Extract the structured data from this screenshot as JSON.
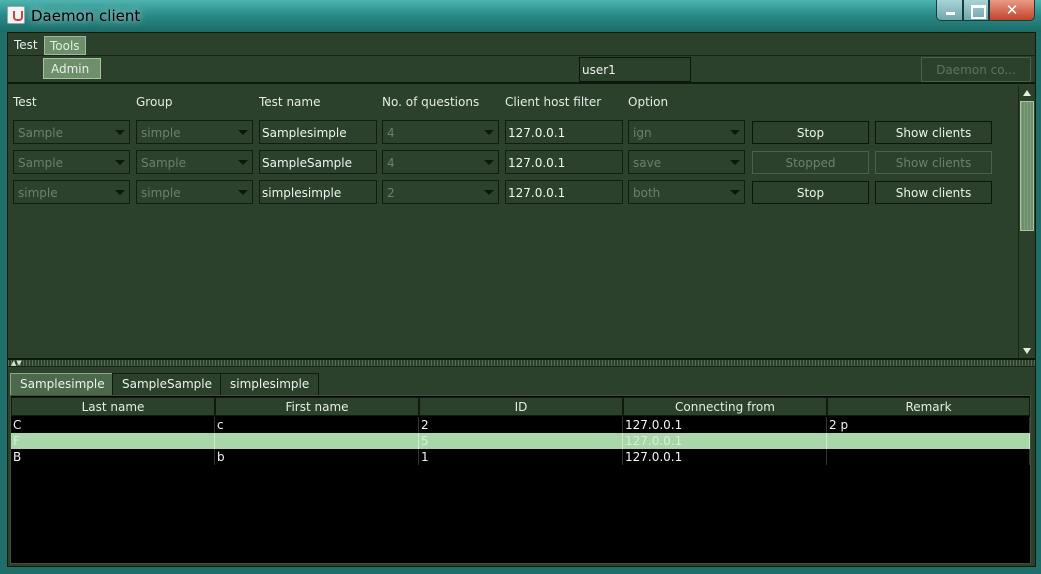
{
  "window": {
    "title": "Daemon client"
  },
  "menu": {
    "items": [
      "Test",
      "Tools"
    ],
    "tools_dropdown": [
      "Admin"
    ]
  },
  "toolbar": {
    "user": "user1",
    "daemon_button": "Daemon co..."
  },
  "columns": {
    "test": "Test",
    "group": "Group",
    "test_name": "Test name",
    "questions": "No. of questions",
    "host_filter": "Client host filter",
    "option": "Option"
  },
  "rows": [
    {
      "test": "Sample",
      "group": "simple",
      "test_name": "Samplesimple",
      "questions": "4",
      "host": "127.0.0.1",
      "option": "ign",
      "action": "Stop",
      "show": "Show clients",
      "enabled": true
    },
    {
      "test": "Sample",
      "group": "Sample",
      "test_name": "SampleSample",
      "questions": "4",
      "host": "127.0.0.1",
      "option": "save",
      "action": "Stopped",
      "show": "Show clients",
      "enabled": false
    },
    {
      "test": "simple",
      "group": "simple",
      "test_name": "simplesimple",
      "questions": "2",
      "host": "127.0.0.1",
      "option": "both",
      "action": "Stop",
      "show": "Show clients",
      "enabled": true
    }
  ],
  "tabs": [
    "Samplesimple",
    "SampleSample",
    "simplesimple"
  ],
  "active_tab": 0,
  "table": {
    "headers": [
      "Last name",
      "First name",
      "ID",
      "Connecting from",
      "Remark"
    ],
    "rows": [
      [
        "C",
        "c",
        "2",
        "127.0.0.1",
        "2 p"
      ],
      [
        "F",
        "",
        "5",
        "127.0.0.1",
        ""
      ],
      [
        "B",
        "b",
        "1",
        "127.0.0.1",
        ""
      ]
    ],
    "selected_row": 1
  }
}
